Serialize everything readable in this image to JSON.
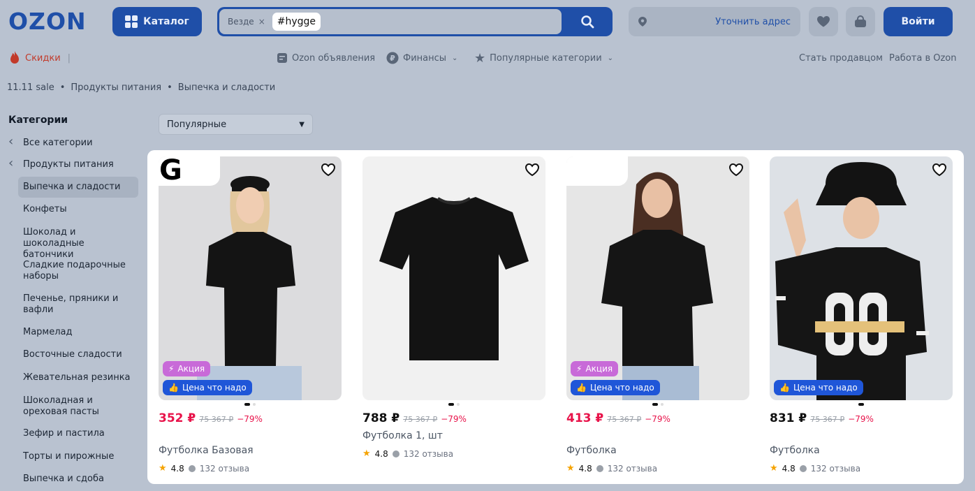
{
  "header": {
    "logo": "OZON",
    "catalog_label": "Каталог",
    "search": {
      "scope": "Везде",
      "scope_clear": "×",
      "tag": "#hygge",
      "placeholder": ""
    },
    "address_label": "Уточнить адрес",
    "login_label": "Войти"
  },
  "subnav": {
    "sale": "Скидки",
    "ads": "Ozon объявления",
    "finance": "Финансы",
    "popular": "Популярные категории",
    "become_seller": "Стать продавцом",
    "work": "Работа в Ozon"
  },
  "breadcrumb": [
    "11.11 sale",
    "Продукты питания",
    "Выпечка и сладости"
  ],
  "sidebar": {
    "title": "Категории",
    "back_items": [
      "Все категории",
      "Продукты питания"
    ],
    "items": [
      "Выпечка и сладости",
      "Конфеты",
      "Шоколад и шоколадные батончики",
      "Сладкие подарочные наборы",
      "Печенье, пряники и вафли",
      "Мармелад",
      "Восточные сладости",
      "Жевательная резинка",
      "Шоколадная и ореховая пасты",
      "Зефир и пастила",
      "Торты и пирожные",
      "Выпечка и сдоба"
    ]
  },
  "sort": {
    "selected": "Популярные"
  },
  "products": [
    {
      "brand": "G",
      "promo": "Акция",
      "price_badge": "Цена что надо",
      "price": "352 ₽",
      "old_price": "75 367 ₽",
      "discount": "−79%",
      "name": "Футболка Базовая",
      "rating": "4.8",
      "reviews": "132 отзыва"
    },
    {
      "price": "788 ₽",
      "old_price": "75 367 ₽",
      "discount": "−79%",
      "name": "Футболка 1, шт",
      "rating": "4.8",
      "reviews": "132 отзыва"
    },
    {
      "promo": "Акция",
      "price_badge": "Цена что надо",
      "price": "413 ₽",
      "old_price": "75 367 ₽",
      "discount": "−79%",
      "name": "Футболка",
      "rating": "4.8",
      "reviews": "132 отзыва"
    },
    {
      "price_badge": "Цена что надо",
      "price": "831 ₽",
      "old_price": "75 367 ₽",
      "discount": "−79%",
      "name": "Футболка",
      "rating": "4.8",
      "reviews": "132 отзыва"
    }
  ],
  "colors": {
    "brand_blue": "#1f4fa8",
    "price_red": "#e8134a",
    "promo_purple": "#c86ad8",
    "badge_blue": "#1f56d8",
    "overlay": "#b9c2d0"
  }
}
